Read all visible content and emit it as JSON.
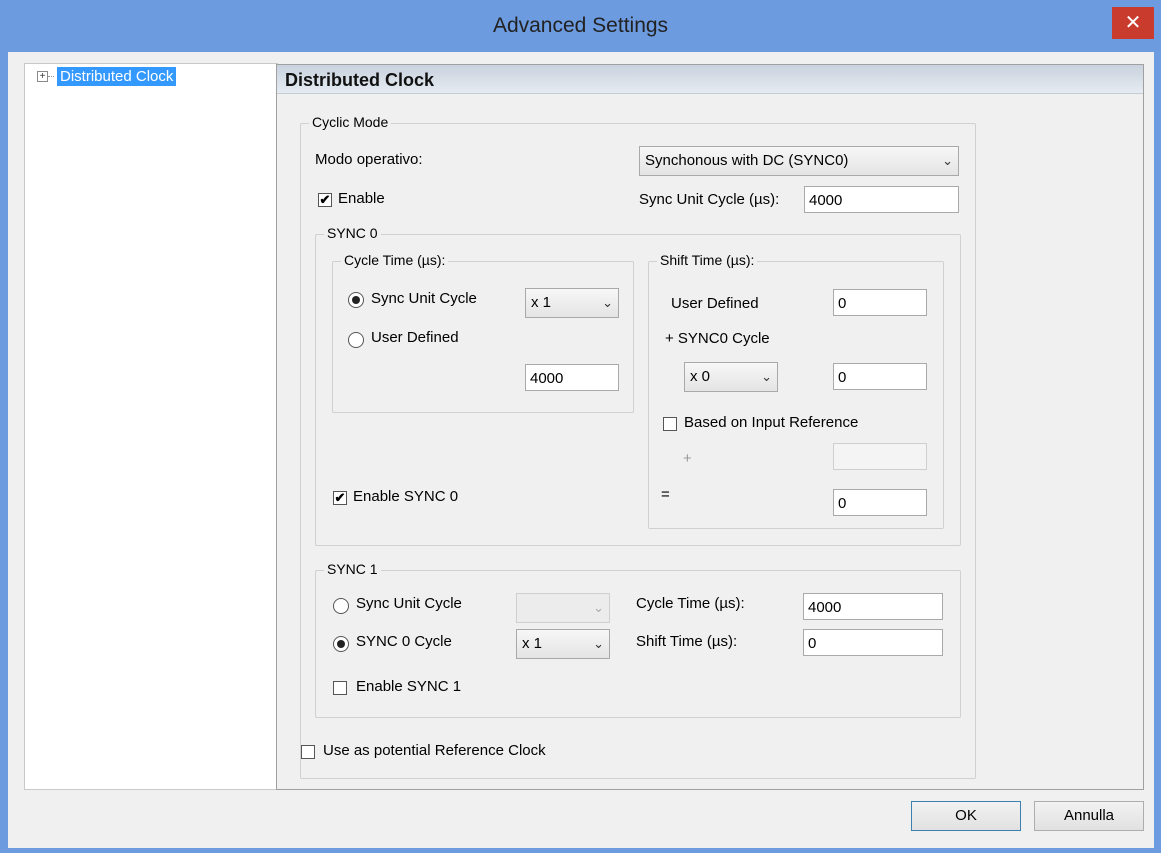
{
  "window": {
    "title": "Advanced Settings",
    "close_glyph": "✕"
  },
  "tree": {
    "expander": "+",
    "item_label": "Distributed Clock"
  },
  "panel": {
    "title": "Distributed Clock",
    "cyclic_mode": {
      "legend": "Cyclic Mode",
      "mode_label": "Modo operativo:",
      "mode_value": "Synchonous with DC (SYNC0)",
      "enable_label": "Enable",
      "enable_checked": true,
      "sync_unit_cycle_label": "Sync Unit Cycle (µs):",
      "sync_unit_cycle_value": "4000"
    },
    "sync0": {
      "legend": "SYNC 0",
      "cycle_time": {
        "legend": "Cycle Time (µs):",
        "sync_unit_cycle_label": "Sync Unit Cycle",
        "multiplier_value": "x 1",
        "user_defined_label": "User Defined",
        "user_defined_value": "4000"
      },
      "shift_time": {
        "legend": "Shift Time (µs):",
        "user_defined_label": "User Defined",
        "user_defined_value": "0",
        "sync0_cycle_label": "+ SYNC0 Cycle",
        "sync0_multiplier": "x 0",
        "sync0_value": "0",
        "based_on_input_label": "Based on Input Reference",
        "plus_label": "+",
        "plus_value": "",
        "equals_label": "=",
        "equals_value": "0"
      },
      "enable_label": "Enable SYNC 0",
      "enable_checked": true
    },
    "sync1": {
      "legend": "SYNC 1",
      "sync_unit_cycle_label": "Sync Unit Cycle",
      "sync_unit_combo_value": "",
      "sync0_cycle_label": "SYNC 0 Cycle",
      "sync0_multiplier": "x 1",
      "cycle_time_label": "Cycle Time (µs):",
      "cycle_time_value": "4000",
      "shift_time_label": "Shift Time (µs):",
      "shift_time_value": "0",
      "enable_label": "Enable SYNC 1",
      "enable_checked": false
    },
    "reference_clock_label": "Use as potential Reference Clock"
  },
  "buttons": {
    "ok": "OK",
    "cancel": "Annulla"
  },
  "icons": {
    "check": "✔",
    "dropdown": "⌄"
  }
}
